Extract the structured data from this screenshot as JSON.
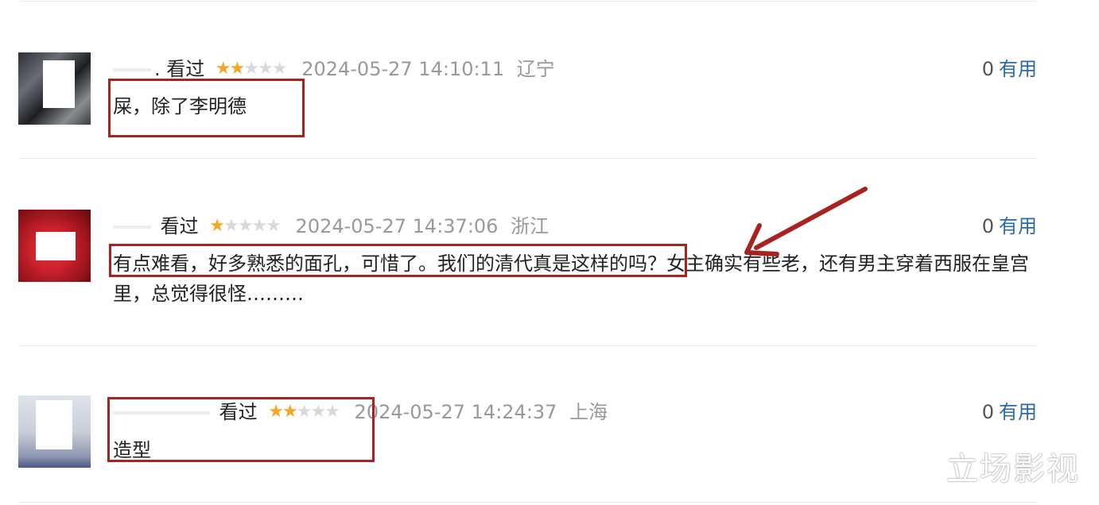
{
  "comments": [
    {
      "username_suffix": ".",
      "watched": "看过",
      "stars": "★★☆☆☆",
      "stars_on": "★★",
      "stars_off": "★★★",
      "time": "2024-05-27 14:10:11",
      "location": "辽宁",
      "useful_count": "0",
      "useful_label": "有用",
      "text": "屎，除了李明德"
    },
    {
      "username_suffix": "",
      "watched": "看过",
      "stars_on": "★",
      "stars_off": "★★★★",
      "time": "2024-05-27 14:37:06",
      "location": "浙江",
      "useful_count": "0",
      "useful_label": "有用",
      "text": "有点难看，好多熟悉的面孔，可惜了。我们的清代真是这样的吗？女主确实有些老，还有男主穿着西服在皇宫里，总觉得很怪………"
    },
    {
      "username_suffix": "",
      "watched": "看过",
      "stars_on": "★★",
      "stars_off": "★★★",
      "time": "2024-05-27 14:24:37",
      "location": "上海",
      "useful_count": "0",
      "useful_label": "有用",
      "text": "造型"
    }
  ],
  "watermark": "立场影视",
  "colors": {
    "annotation_red": "#a8231f",
    "star_on": "#f5a623",
    "star_off": "#d9d9d9",
    "link_blue": "#2b6aa8",
    "meta_gray": "#999999"
  }
}
